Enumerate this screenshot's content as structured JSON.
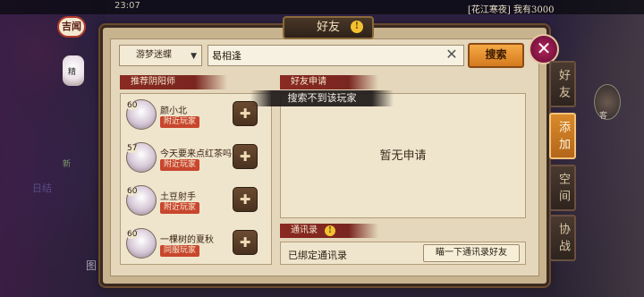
{
  "status_bar": {
    "time": "23:07",
    "status_text": "[花江寒夜] 我有3000"
  },
  "background": {
    "badge_jixiong": "吉闻",
    "lantern_text": "精",
    "word_xin": "新",
    "word_rijie": "日结",
    "word_tu": "图",
    "word_ke": "客"
  },
  "panel": {
    "title": "好友"
  },
  "search": {
    "server_dropdown": "游梦迷蝶",
    "query": "曷相逢",
    "button": "搜索"
  },
  "toast": "搜索不到该玩家",
  "recommend": {
    "header": "推荐阴阳师",
    "items": [
      {
        "level": "60",
        "name": "颜小北",
        "tag": "附近玩家"
      },
      {
        "level": "57",
        "name": "今天要来点红茶吗",
        "tag": "附近玩家"
      },
      {
        "level": "60",
        "name": "土豆射手",
        "tag": "附近玩家"
      },
      {
        "level": "60",
        "name": "一棵树的夏秋",
        "tag": "同服玩家"
      }
    ]
  },
  "requests": {
    "header": "好友申请",
    "empty_text": "暂无申请"
  },
  "contacts": {
    "header": "通讯录",
    "label": "已绑定通讯录",
    "button": "瞄一下通讯录好友"
  },
  "side_tabs": {
    "friends": "好友",
    "add": "添加",
    "space": "空间",
    "coop": "协战"
  },
  "icons": {
    "close": "close-icon",
    "clear": "clear-icon",
    "add_friend": "add-friend-icon",
    "dropdown": "chevron-down-icon"
  },
  "colors": {
    "accent_orange": "#d47a1f",
    "tag_red": "#c8462e",
    "header_red": "#8a2a22",
    "panel_bg": "#e4d7bb"
  }
}
